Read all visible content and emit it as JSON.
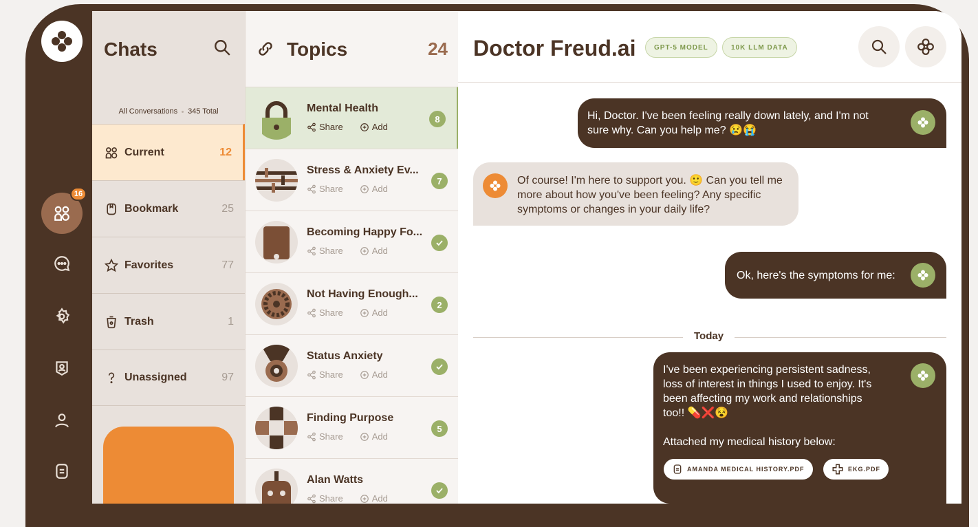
{
  "colors": {
    "brand": "#4b3425",
    "accent": "#ed8b35",
    "green": "#9bb068",
    "cream": "#fde9cf"
  },
  "rail": {
    "badge": "16",
    "items": [
      "people-icon",
      "chat-icon",
      "gear-icon",
      "alert-icon",
      "user-icon",
      "document-icon"
    ]
  },
  "chats": {
    "title": "Chats",
    "all_label": "All Conversations",
    "total_label": "345 Total",
    "categories": [
      {
        "label": "Current",
        "count": "12",
        "icon": "people-icon"
      },
      {
        "label": "Bookmark",
        "count": "25",
        "icon": "bookmark-icon"
      },
      {
        "label": "Favorites",
        "count": "77",
        "icon": "star-icon"
      },
      {
        "label": "Trash",
        "count": "1",
        "icon": "trash-icon"
      },
      {
        "label": "Unassigned",
        "count": "97",
        "icon": "question-icon"
      }
    ]
  },
  "topics": {
    "title": "Topics",
    "count": "24",
    "share_label": "Share",
    "add_label": "Add",
    "items": [
      {
        "title": "Mental Health",
        "count": "8"
      },
      {
        "title": "Stress & Anxiety Ev...",
        "count": "7"
      },
      {
        "title": "Becoming Happy Fo...",
        "count": ""
      },
      {
        "title": "Not Having Enough...",
        "count": "2"
      },
      {
        "title": "Status Anxiety",
        "count": ""
      },
      {
        "title": "Finding Purpose",
        "count": "5"
      },
      {
        "title": "Alan Watts",
        "count": ""
      }
    ]
  },
  "main": {
    "title": "Doctor Freud.ai",
    "pill1": "GPT-5 MODEL",
    "pill2": "10K LLM DATA",
    "messages": [
      {
        "from": "user",
        "text": "Hi, Doctor. I've been feeling really down lately, and I'm not sure why. Can you help me? 😢😭"
      },
      {
        "from": "bot",
        "text": "Of course! I'm here to support you. 🙂 Can you tell me more about how you've been feeling? Any specific symptoms or changes in your daily life?"
      },
      {
        "from": "user",
        "text": "Ok, here's the symptoms for me:"
      },
      {
        "from": "user",
        "text": "I've been experiencing persistent sadness, loss of interest in things I used to enjoy. It's been affecting my work and relationships too!! 💊❌😵",
        "text2": "Attached my medical history below:"
      }
    ],
    "divider": "Today",
    "attachments": [
      "AMANDA MEDICAL HISTORY.PDF",
      "EKG.PDF"
    ]
  }
}
